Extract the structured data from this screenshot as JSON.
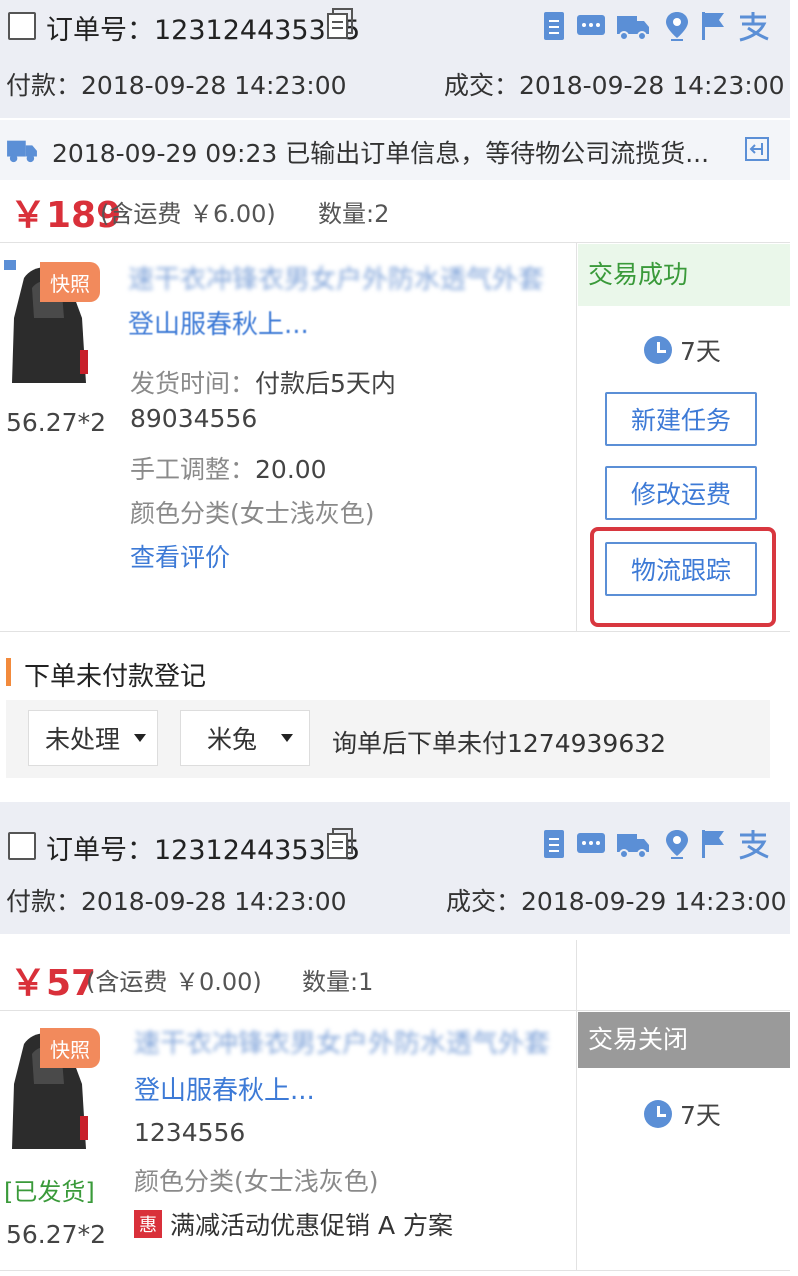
{
  "orders": [
    {
      "order_no_label": "订单号：",
      "order_no": "123124435345",
      "paid_label": "付款：",
      "paid_time": "2018-09-28 14:23:00",
      "deal_label": "成交：",
      "deal_time": "2018-09-28 14:23:00",
      "logistics_text": "2018-09-29 09:23 已输出订单信息，等待物公司流揽货...",
      "price": "￥189",
      "shipping_note": "(含运费 ￥6.00)",
      "quantity": "数量:2",
      "snapshot_badge": "快照",
      "title_line1": "速干衣冲锋衣男女户外防水透气外套",
      "title_line2": "登山服春秋上...",
      "unit_price_qty": "56.27*2",
      "ship_time_label": "发货时间：",
      "ship_time_value": "付款后5天内",
      "sku_code": "89034556",
      "manual_adjust_label": "手工调整：",
      "manual_adjust_value": "20.00",
      "color_category": "颜色分类(女士浅灰色)",
      "view_review": "查看评价",
      "status": "交易成功",
      "days": "7天",
      "actions": [
        "新建任务",
        "修改运费",
        "物流跟踪"
      ]
    },
    {
      "order_no_label": "订单号：",
      "order_no": "123124435345",
      "paid_label": "付款：",
      "paid_time": "2018-09-28 14:23:00",
      "deal_label": "成交：",
      "deal_time": "2018-09-29 14:23:00",
      "price": "￥57",
      "shipping_note": "(含运费 ￥0.00)",
      "quantity": "数量:1",
      "snapshot_badge": "快照",
      "title_line1": "速干衣冲锋衣男女户外防水透气外套",
      "title_line2": "登山服春秋上...",
      "sku_code": "1234556",
      "color_category": "颜色分类(女士浅灰色)",
      "shipped_tag": "[已发货]",
      "unit_price_qty": "56.27*2",
      "promo_icon": "惠",
      "promo_text": "满减活动优惠促销 A 方案",
      "status": "交易关闭",
      "days": "7天"
    }
  ],
  "unpaid_register": {
    "title": "下单未付款登记",
    "status_select": "未处理",
    "staff_select": "米兔",
    "note": "询单后下单未付1274939632"
  },
  "header_icons": [
    "memo-icon",
    "chat-icon",
    "truck-icon",
    "location-icon",
    "flag-icon",
    "alipay-icon"
  ],
  "colors": {
    "accent": "#3d7ad6",
    "price": "#d9303a",
    "success": "#3a9a3a",
    "highlight": "#d8373f"
  }
}
